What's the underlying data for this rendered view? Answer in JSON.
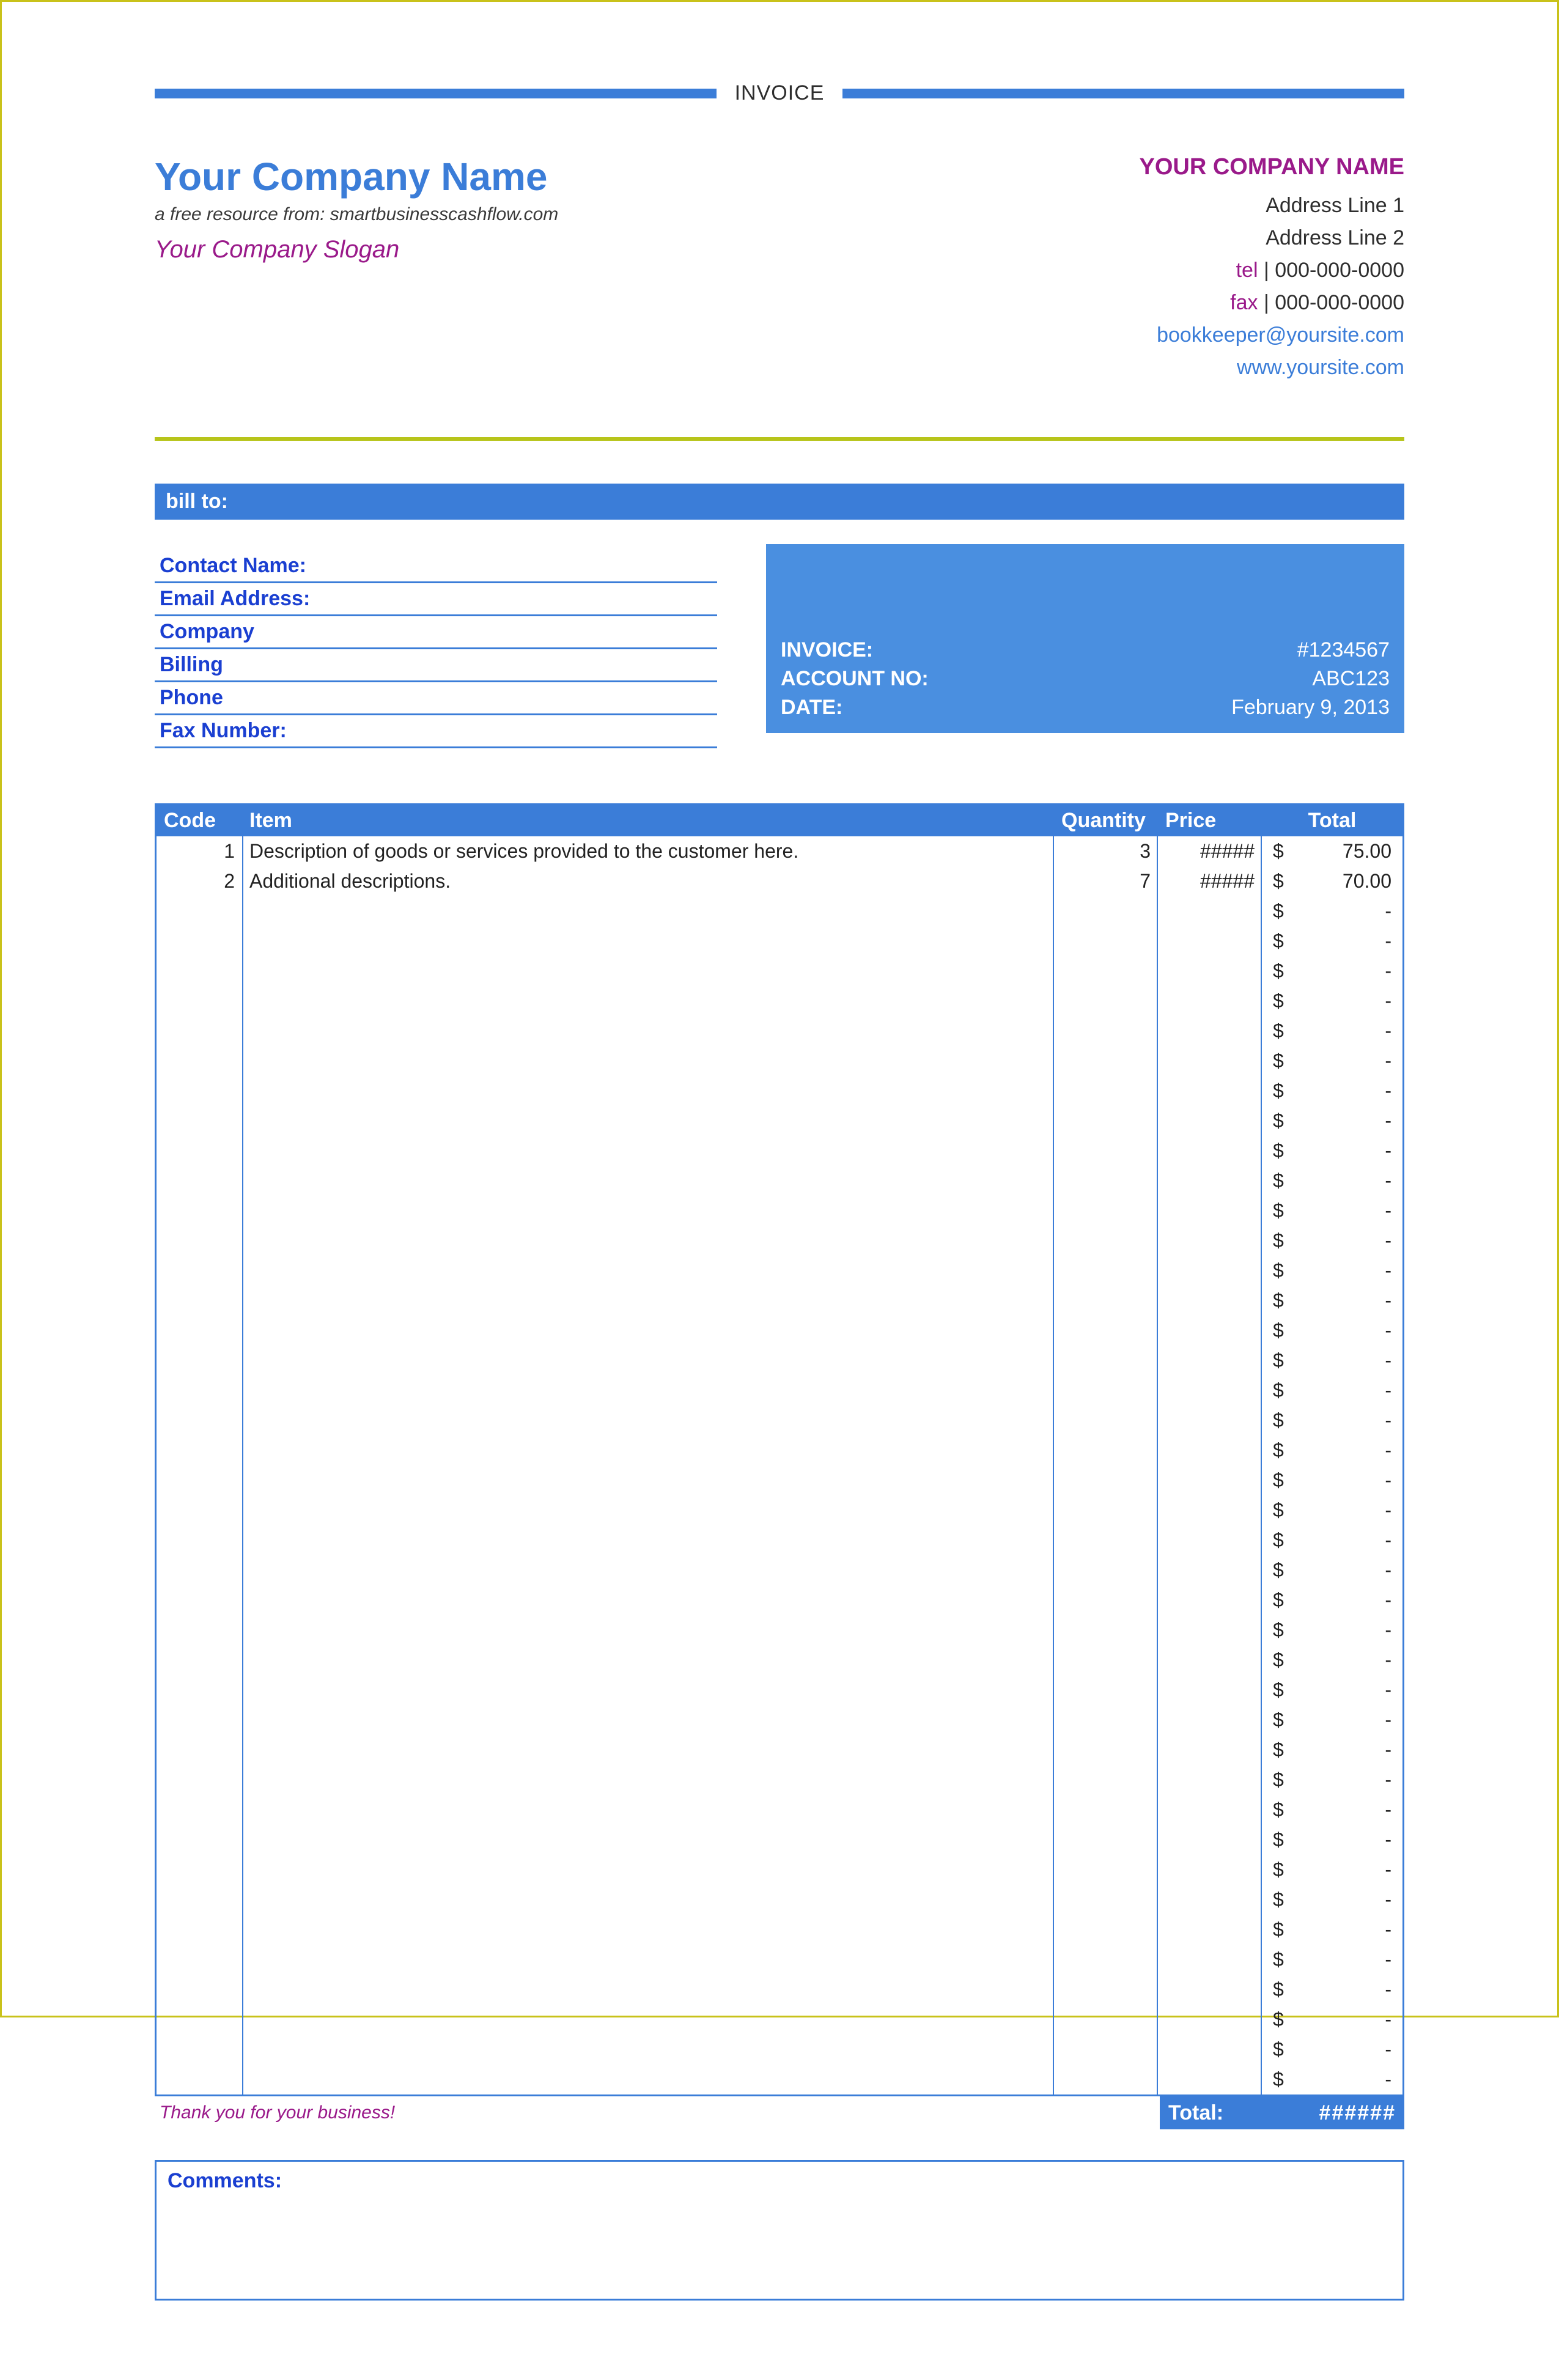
{
  "title": "INVOICE",
  "company": {
    "name": "Your Company Name",
    "resource_line": "a free resource from: smartbusinesscashflow.com",
    "slogan": "Your Company Slogan"
  },
  "company_right": {
    "name": "YOUR COMPANY NAME",
    "address1": "Address Line 1",
    "address2": "Address Line 2",
    "tel_label": "tel",
    "tel": "000-000-0000",
    "fax_label": "fax",
    "fax": "000-000-0000",
    "email": "bookkeeper@yoursite.com",
    "website": "www.yoursite.com"
  },
  "billto": {
    "header": "bill to:",
    "fields": {
      "contact_name": "Contact Name:",
      "email_address": "Email Address:",
      "company": "Company",
      "billing": "Billing",
      "phone": "Phone",
      "fax_number": "Fax Number:"
    }
  },
  "meta": {
    "invoice_label": "INVOICE:",
    "invoice_value": "#1234567",
    "account_label": "ACCOUNT NO:",
    "account_value": "ABC123",
    "date_label": "DATE:",
    "date_value": "February 9, 2013"
  },
  "columns": {
    "code": "Code",
    "item": "Item",
    "qty": "Quantity",
    "price": "Price",
    "total": "Total"
  },
  "lines": [
    {
      "code": "1",
      "item": "Description of goods or services provided to the customer here.",
      "qty": "3",
      "price": "#####",
      "currency": "$",
      "total": "75.00"
    },
    {
      "code": "2",
      "item": "Additional descriptions.",
      "qty": "7",
      "price": "#####",
      "currency": "$",
      "total": "70.00"
    },
    {
      "code": "",
      "item": "",
      "qty": "",
      "price": "",
      "currency": "$",
      "total": "-"
    },
    {
      "code": "",
      "item": "",
      "qty": "",
      "price": "",
      "currency": "$",
      "total": "-"
    },
    {
      "code": "",
      "item": "",
      "qty": "",
      "price": "",
      "currency": "$",
      "total": "-"
    },
    {
      "code": "",
      "item": "",
      "qty": "",
      "price": "",
      "currency": "$",
      "total": "-"
    },
    {
      "code": "",
      "item": "",
      "qty": "",
      "price": "",
      "currency": "$",
      "total": "-"
    },
    {
      "code": "",
      "item": "",
      "qty": "",
      "price": "",
      "currency": "$",
      "total": "-"
    },
    {
      "code": "",
      "item": "",
      "qty": "",
      "price": "",
      "currency": "$",
      "total": "-"
    },
    {
      "code": "",
      "item": "",
      "qty": "",
      "price": "",
      "currency": "$",
      "total": "-"
    },
    {
      "code": "",
      "item": "",
      "qty": "",
      "price": "",
      "currency": "$",
      "total": "-"
    },
    {
      "code": "",
      "item": "",
      "qty": "",
      "price": "",
      "currency": "$",
      "total": "-"
    },
    {
      "code": "",
      "item": "",
      "qty": "",
      "price": "",
      "currency": "$",
      "total": "-"
    },
    {
      "code": "",
      "item": "",
      "qty": "",
      "price": "",
      "currency": "$",
      "total": "-"
    },
    {
      "code": "",
      "item": "",
      "qty": "",
      "price": "",
      "currency": "$",
      "total": "-"
    },
    {
      "code": "",
      "item": "",
      "qty": "",
      "price": "",
      "currency": "$",
      "total": "-"
    },
    {
      "code": "",
      "item": "",
      "qty": "",
      "price": "",
      "currency": "$",
      "total": "-"
    },
    {
      "code": "",
      "item": "",
      "qty": "",
      "price": "",
      "currency": "$",
      "total": "-"
    },
    {
      "code": "",
      "item": "",
      "qty": "",
      "price": "",
      "currency": "$",
      "total": "-"
    },
    {
      "code": "",
      "item": "",
      "qty": "",
      "price": "",
      "currency": "$",
      "total": "-"
    },
    {
      "code": "",
      "item": "",
      "qty": "",
      "price": "",
      "currency": "$",
      "total": "-"
    },
    {
      "code": "",
      "item": "",
      "qty": "",
      "price": "",
      "currency": "$",
      "total": "-"
    },
    {
      "code": "",
      "item": "",
      "qty": "",
      "price": "",
      "currency": "$",
      "total": "-"
    },
    {
      "code": "",
      "item": "",
      "qty": "",
      "price": "",
      "currency": "$",
      "total": "-"
    },
    {
      "code": "",
      "item": "",
      "qty": "",
      "price": "",
      "currency": "$",
      "total": "-"
    },
    {
      "code": "",
      "item": "",
      "qty": "",
      "price": "",
      "currency": "$",
      "total": "-"
    },
    {
      "code": "",
      "item": "",
      "qty": "",
      "price": "",
      "currency": "$",
      "total": "-"
    },
    {
      "code": "",
      "item": "",
      "qty": "",
      "price": "",
      "currency": "$",
      "total": "-"
    },
    {
      "code": "",
      "item": "",
      "qty": "",
      "price": "",
      "currency": "$",
      "total": "-"
    },
    {
      "code": "",
      "item": "",
      "qty": "",
      "price": "",
      "currency": "$",
      "total": "-"
    },
    {
      "code": "",
      "item": "",
      "qty": "",
      "price": "",
      "currency": "$",
      "total": "-"
    },
    {
      "code": "",
      "item": "",
      "qty": "",
      "price": "",
      "currency": "$",
      "total": "-"
    },
    {
      "code": "",
      "item": "",
      "qty": "",
      "price": "",
      "currency": "$",
      "total": "-"
    },
    {
      "code": "",
      "item": "",
      "qty": "",
      "price": "",
      "currency": "$",
      "total": "-"
    },
    {
      "code": "",
      "item": "",
      "qty": "",
      "price": "",
      "currency": "$",
      "total": "-"
    },
    {
      "code": "",
      "item": "",
      "qty": "",
      "price": "",
      "currency": "$",
      "total": "-"
    },
    {
      "code": "",
      "item": "",
      "qty": "",
      "price": "",
      "currency": "$",
      "total": "-"
    },
    {
      "code": "",
      "item": "",
      "qty": "",
      "price": "",
      "currency": "$",
      "total": "-"
    },
    {
      "code": "",
      "item": "",
      "qty": "",
      "price": "",
      "currency": "$",
      "total": "-"
    },
    {
      "code": "",
      "item": "",
      "qty": "",
      "price": "",
      "currency": "$",
      "total": "-"
    },
    {
      "code": "",
      "item": "",
      "qty": "",
      "price": "",
      "currency": "$",
      "total": "-"
    },
    {
      "code": "",
      "item": "",
      "qty": "",
      "price": "",
      "currency": "$",
      "total": "-"
    }
  ],
  "footer": {
    "thanks": "Thank you for your business!",
    "total_label": "Total:",
    "total_value": "######"
  },
  "comments_label": "Comments:",
  "sep": " | "
}
